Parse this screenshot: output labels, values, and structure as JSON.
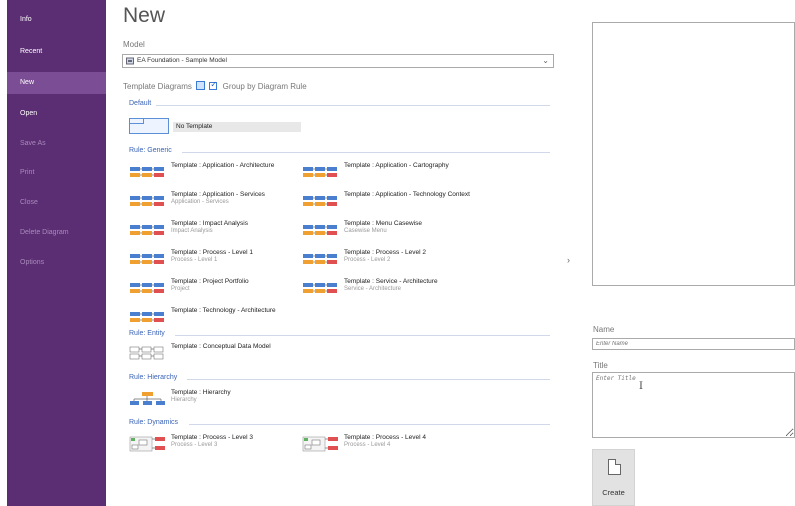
{
  "sidebar": {
    "items": [
      {
        "label": "Info",
        "state": "normal"
      },
      {
        "label": "Recent",
        "state": "normal"
      },
      {
        "label": "New",
        "state": "active"
      },
      {
        "label": "Open",
        "state": "normal"
      },
      {
        "label": "Save As",
        "state": "disabled"
      },
      {
        "label": "Print",
        "state": "disabled"
      },
      {
        "label": "Close",
        "state": "disabled"
      },
      {
        "label": "Delete Diagram",
        "state": "disabled"
      },
      {
        "label": "Options",
        "state": "disabled"
      }
    ]
  },
  "page": {
    "title": "New"
  },
  "model": {
    "label": "Model",
    "value": "EA Foundation - Sample Model"
  },
  "template_diagrams": {
    "label": "Template Diagrams",
    "group_by_label": "Group by Diagram Rule",
    "group_by_checked": true
  },
  "groups": {
    "default": {
      "label": "Default",
      "no_template_label": "No Template"
    },
    "generic": {
      "label": "Rule: Generic",
      "items": [
        {
          "title": "Template : Application - Architecture",
          "subtitle": ""
        },
        {
          "title": "Template : Application - Cartography",
          "subtitle": ""
        },
        {
          "title": "Template : Application - Services",
          "subtitle": "Application - Services"
        },
        {
          "title": "Template : Application - Technology Context",
          "subtitle": ""
        },
        {
          "title": "Template : Impact Analysis",
          "subtitle": "Impact Analysis"
        },
        {
          "title": "Template : Menu Casewise",
          "subtitle": "Casewise Menu"
        },
        {
          "title": "Template : Process - Level 1",
          "subtitle": "Process - Level 1"
        },
        {
          "title": "Template : Process - Level 2",
          "subtitle": "Process - Level 2"
        },
        {
          "title": "Template : Project Portfolio",
          "subtitle": "Project"
        },
        {
          "title": "Template : Service - Architecture",
          "subtitle": "Service - Architecture"
        },
        {
          "title": "Template : Technology - Architecture",
          "subtitle": ""
        }
      ]
    },
    "entity": {
      "label": "Rule: Entity",
      "items": [
        {
          "title": "Template : Conceptual Data Model",
          "subtitle": ""
        }
      ]
    },
    "hierarchy": {
      "label": "Rule: Hierarchy",
      "items": [
        {
          "title": "Template : Hierarchy",
          "subtitle": "Hierarchy"
        }
      ]
    },
    "dynamics": {
      "label": "Rule: Dynamics",
      "items": [
        {
          "title": "Template : Process - Level 3",
          "subtitle": "Process - Level 3"
        },
        {
          "title": "Template : Process - Level 4",
          "subtitle": "Process - Level 4"
        }
      ]
    }
  },
  "expand_arrow": "›",
  "name_field": {
    "label": "Name",
    "placeholder": "Enter Name",
    "value": ""
  },
  "title_field": {
    "label": "Title",
    "placeholder": "Enter Title",
    "value": ""
  },
  "create_button": {
    "label": "Create"
  },
  "colors": {
    "sidebar_bg": "#5b2d73",
    "sidebar_active": "#7b4d95",
    "group_label": "#3a63b7",
    "icon_blue": "#4a7fd0",
    "icon_orange": "#f0a030",
    "icon_red": "#e05050",
    "icon_green": "#60b060"
  }
}
